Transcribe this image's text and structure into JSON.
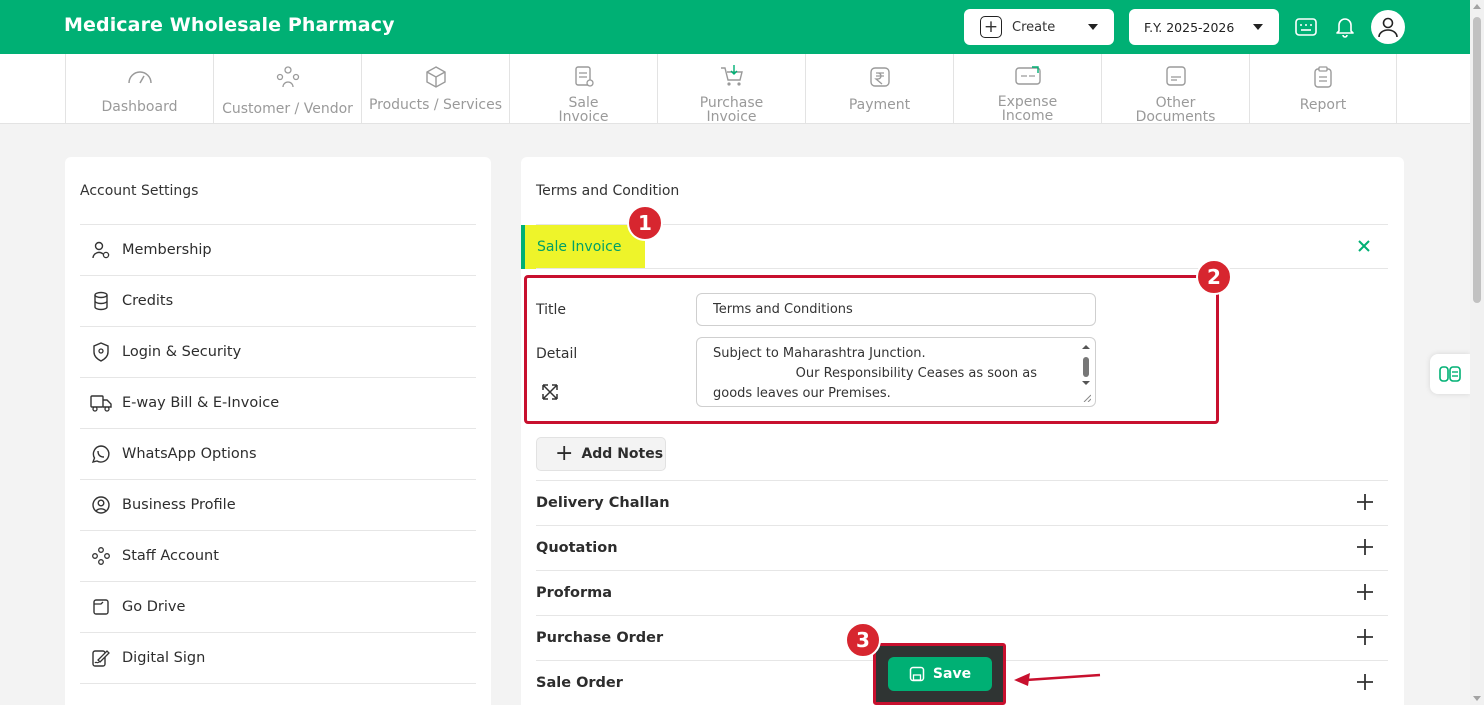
{
  "app": {
    "brand": "Medicare Wholesale Pharmacy"
  },
  "header": {
    "create_label": "Create",
    "fy_label": "F.Y. 2025-2026",
    "icons": [
      "keyboard-icon",
      "bell-icon",
      "user-avatar-icon"
    ]
  },
  "nav": [
    {
      "label": "Dashboard",
      "icon": "speedometer-icon"
    },
    {
      "label": "Customer / Vendor",
      "icon": "users-icon"
    },
    {
      "label": "Products / Services",
      "icon": "box-icon"
    },
    {
      "label": "Sale\nInvoice",
      "icon": "invoice-icon"
    },
    {
      "label": "Purchase\nInvoice",
      "icon": "cart-icon"
    },
    {
      "label": "Payment",
      "icon": "rupee-icon"
    },
    {
      "label": "Expense\nIncome",
      "icon": "wallet-icon"
    },
    {
      "label": "Other\nDocuments",
      "icon": "document-icon"
    },
    {
      "label": "Report",
      "icon": "clipboard-icon"
    }
  ],
  "account_settings": {
    "title": "Account Settings",
    "items": [
      {
        "label": "Membership",
        "icon": "member-icon"
      },
      {
        "label": "Credits",
        "icon": "coins-icon"
      },
      {
        "label": "Login & Security",
        "icon": "shield-icon"
      },
      {
        "label": "E-way Bill & E-Invoice",
        "icon": "truck-icon"
      },
      {
        "label": "WhatsApp Options",
        "icon": "whatsapp-icon"
      },
      {
        "label": "Business Profile",
        "icon": "profile-icon"
      },
      {
        "label": "Staff Account",
        "icon": "staff-icon"
      },
      {
        "label": "Go Drive",
        "icon": "drive-icon"
      },
      {
        "label": "Digital Sign",
        "icon": "sign-icon"
      }
    ]
  },
  "terms": {
    "title": "Terms and Condition",
    "active_tab": "Sale Invoice",
    "title_label": "Title",
    "title_value": "Terms and Conditions",
    "detail_label": "Detail",
    "detail_value": "Subject to Maharashtra Junction.\n                    Our Responsibility Ceases as soon as goods leaves our Premises.",
    "add_notes": "Add Notes",
    "sections": [
      "Delivery Challan",
      "Quotation",
      "Proforma",
      "Purchase Order",
      "Sale Order"
    ],
    "save_label": "Save"
  },
  "annotations": {
    "badge1": "1",
    "badge2": "2",
    "badge3": "3"
  },
  "colors": {
    "brand": "#00b074",
    "highlight": "#eef42a",
    "annotation_red": "#c8102e"
  }
}
